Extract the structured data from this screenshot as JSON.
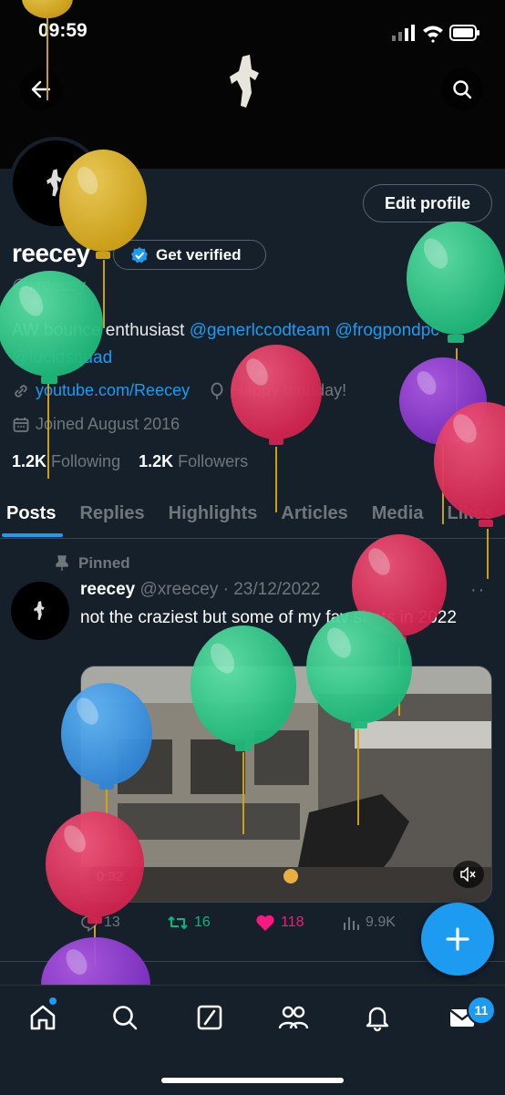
{
  "status_bar": {
    "time": "09:59"
  },
  "profile": {
    "name": "reecey",
    "handle": "@xreecey",
    "verify_label": "Get verified",
    "edit_label": "Edit profile",
    "bio_text": "AW bounce enthusiast ",
    "bio_mentions": [
      "@generlccodteam",
      "@frogpondpc",
      "@lucidsquad"
    ],
    "website": "youtube.com/Reecey",
    "birthday": "Happy birthday!",
    "joined": "Joined August 2016",
    "following_count": "1.2K",
    "following_label": "Following",
    "followers_count": "1.2K",
    "followers_label": "Followers"
  },
  "tabs": [
    "Posts",
    "Replies",
    "Highlights",
    "Articles",
    "Media",
    "Likes"
  ],
  "tweet": {
    "pinned_label": "Pinned",
    "name": "reecey",
    "handle_date": "@xreecey · 23/12/2022",
    "text": "not the craziest but some of my fav shots in 2022",
    "duration": "0:32",
    "replies": "13",
    "retweets": "16",
    "likes": "118",
    "views": "9.9K"
  },
  "nav": {
    "messages_badge": "11"
  },
  "icons": [
    "back-icon",
    "search-icon",
    "verified-badge-icon",
    "link-icon",
    "balloon-icon",
    "calendar-icon",
    "pin-icon",
    "reply-icon",
    "retweet-icon",
    "heart-icon",
    "views-icon",
    "mute-icon",
    "compose-icon",
    "home-icon",
    "grok-icon",
    "communities-icon",
    "bell-icon",
    "mail-icon"
  ],
  "colors": {
    "background": "#15202b",
    "accent": "#1d9bf0",
    "retweet": "#00ba7c",
    "like": "#f91880"
  }
}
